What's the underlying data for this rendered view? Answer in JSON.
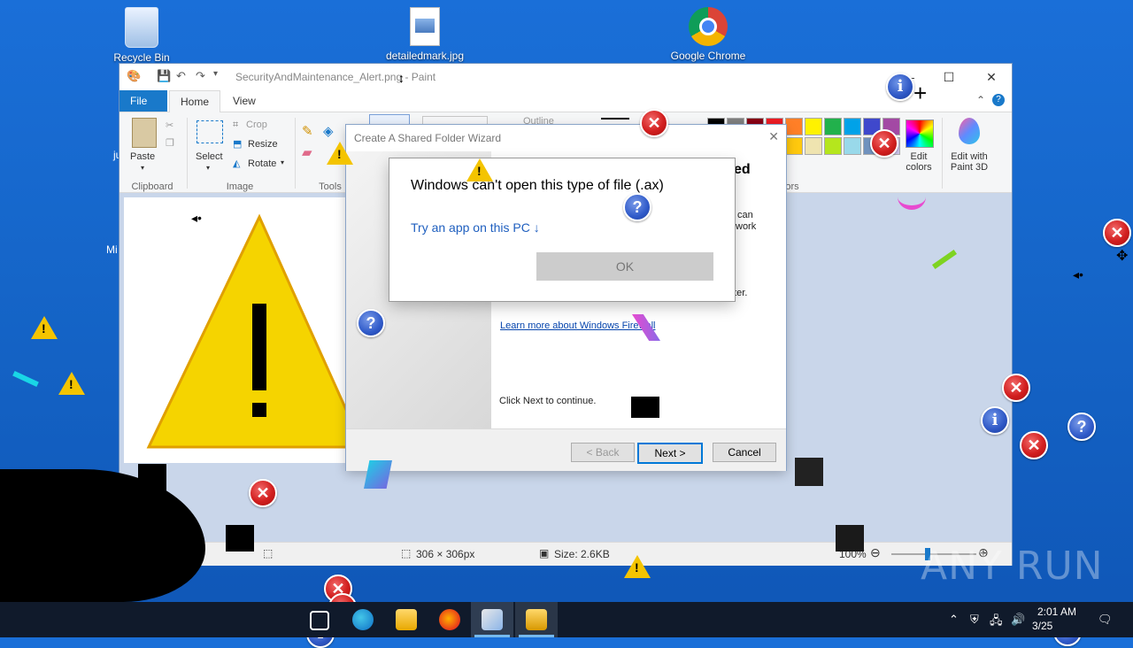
{
  "desktop": {
    "icons": [
      {
        "label": "Recycle Bin"
      },
      {
        "label": "detailedmark.jpg"
      },
      {
        "label": "Google Chrome"
      }
    ],
    "partial_labels": [
      "ju",
      "Mi"
    ]
  },
  "paint": {
    "title": "SecurityAndMaintenance_Alert.png - Paint",
    "tabs": {
      "file": "File",
      "home": "Home",
      "view": "View"
    },
    "ribbon": {
      "paste": "Paste",
      "select": "Select",
      "crop": "Crop",
      "resize": "Resize",
      "rotate": "Rotate",
      "outline": "Outline",
      "edit_colors": "Edit colors",
      "edit_paint3d": "Edit with Paint 3D",
      "group_clipboard": "Clipboard",
      "group_image": "Image",
      "group_tools": "Tools",
      "group_colors": "ors"
    },
    "palette": [
      "#000000",
      "#7f7f7f",
      "#880015",
      "#ed1c24",
      "#ff7f27",
      "#fff200",
      "#22b14c",
      "#00a2e8",
      "#3f48cc",
      "#a349a4",
      "#ffffff",
      "#c3c3c3",
      "#b97a57",
      "#ffaec9",
      "#ffc90e",
      "#efe4b0",
      "#b5e61d",
      "#99d9ea",
      "#7092be",
      "#c8bfe7"
    ],
    "status": {
      "dimensions": "306 × 306px",
      "size": "Size: 2.6KB",
      "zoom": "100%"
    }
  },
  "wizard": {
    "title": "Create A Shared Folder Wizard",
    "heading_fragment": "ed",
    "text_fragment_1": "can",
    "text_fragment_2": "work",
    "text_fragment_3": "uter.",
    "firewall_link": "Learn more about Windows Firewall",
    "continue_text": "Click Next to continue.",
    "back_label": "< Back",
    "next_label": "Next >",
    "cancel_label": "Cancel"
  },
  "openwith": {
    "message": "Windows can't open this type of file (.ax)",
    "try_app": "Try an app on this PC ↓",
    "ok_label": "OK"
  },
  "taskbar": {
    "time": "2:01 AM",
    "date": "3/25"
  },
  "watermark": "ANY RUN"
}
